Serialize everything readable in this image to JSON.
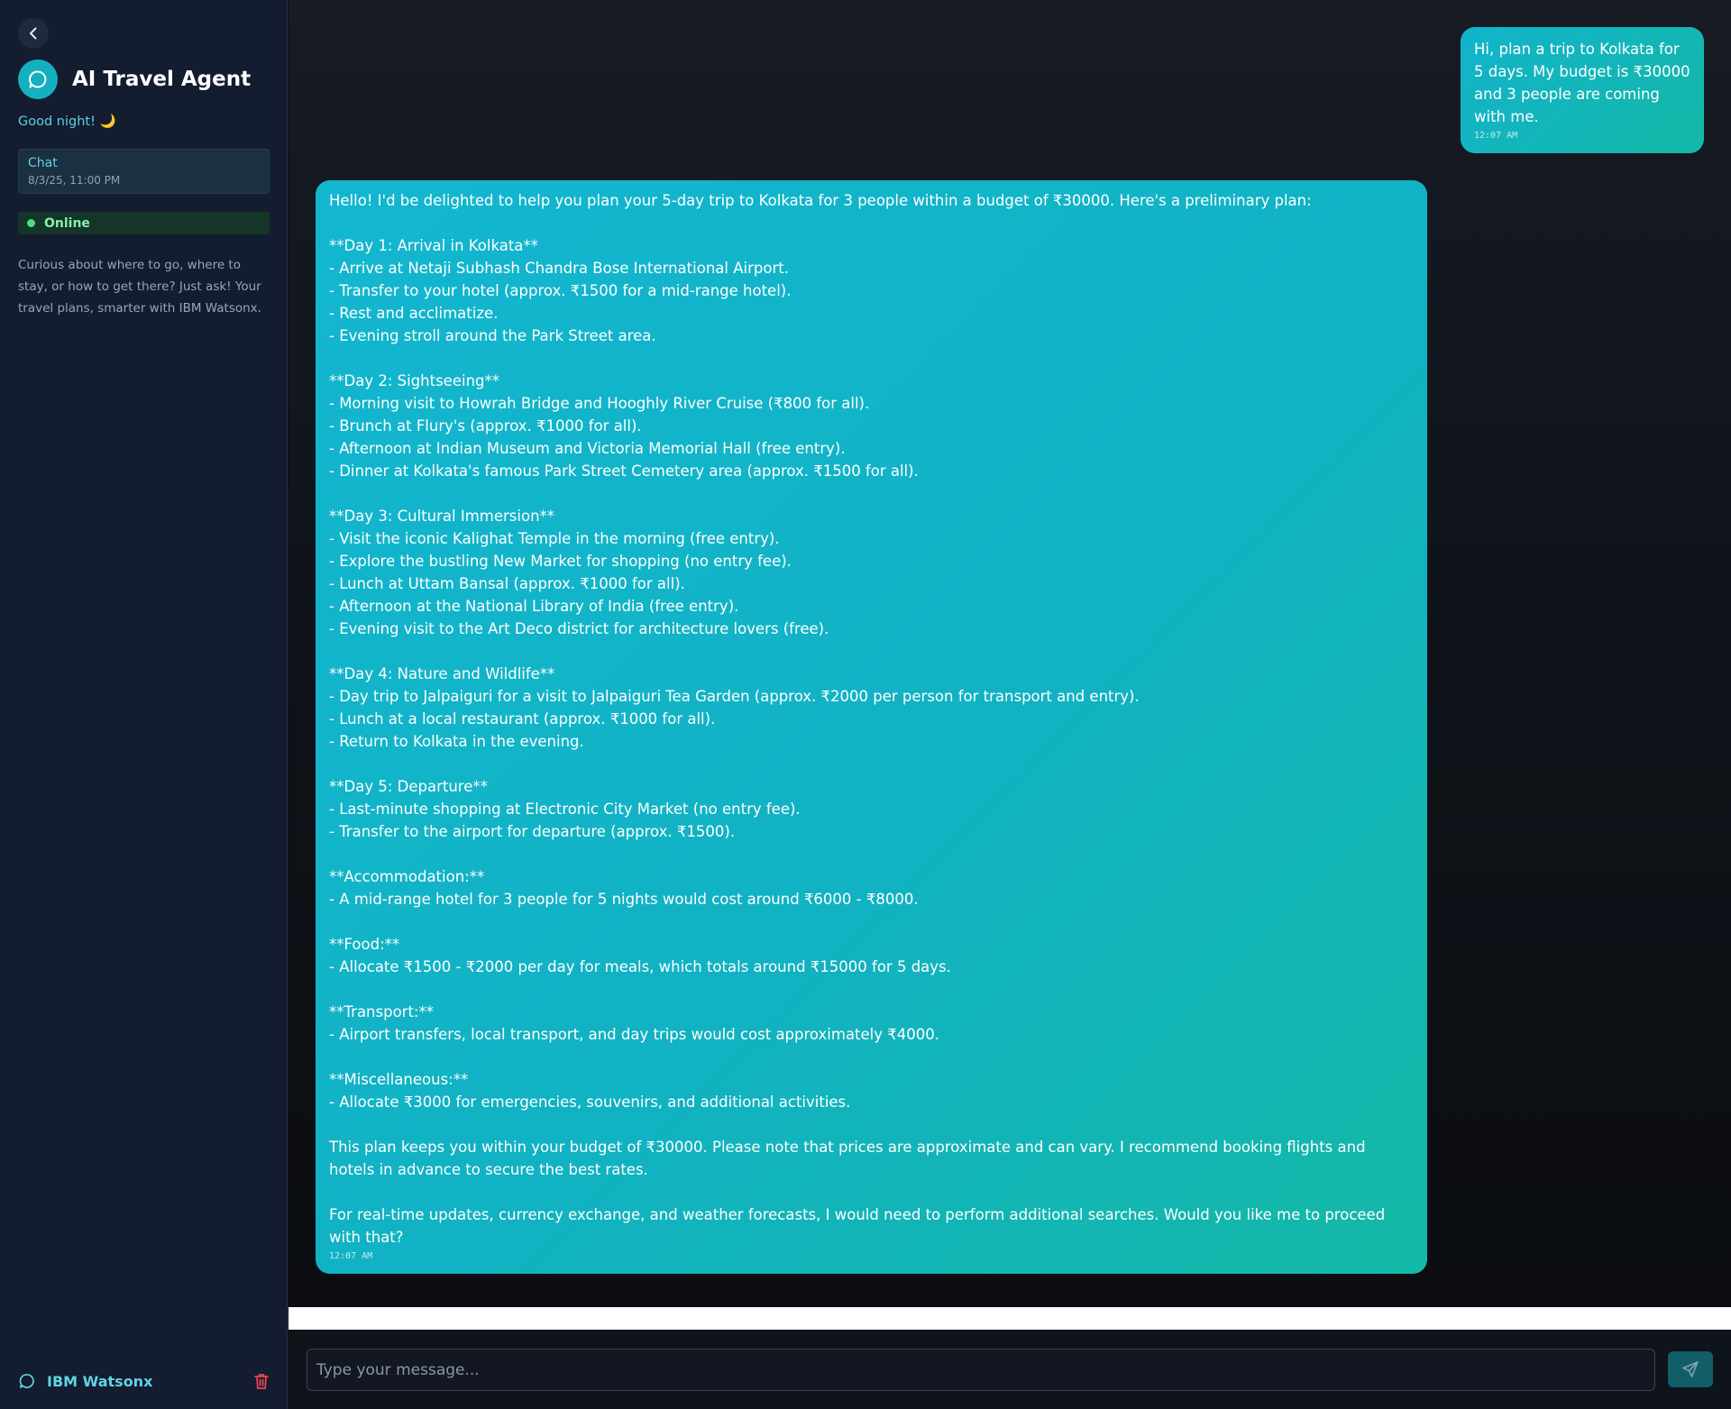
{
  "sidebar": {
    "title": "AI Travel Agent",
    "greeting": "Good night! 🌙",
    "chat_item": {
      "title": "Chat",
      "date": "8/3/25, 11:00 PM"
    },
    "status": "Online",
    "description": "Curious about where to go, where to stay, or how to get there? Just ask! Your travel plans, smarter with IBM Watsonx.",
    "footer_label": "IBM Watsonx"
  },
  "messages": [
    {
      "role": "user",
      "text": "Hi, plan a trip to Kolkata for 5 days. My budget is ₹30000 and 3 people are coming with me.",
      "time": "12:07 AM"
    },
    {
      "role": "assistant",
      "text": "Hello! I'd be delighted to help you plan your 5-day trip to Kolkata for 3 people within a budget of ₹30000. Here's a preliminary plan:\n\n**Day 1: Arrival in Kolkata**\n- Arrive at Netaji Subhash Chandra Bose International Airport.\n- Transfer to your hotel (approx. ₹1500 for a mid-range hotel).\n- Rest and acclimatize.\n- Evening stroll around the Park Street area.\n\n**Day 2: Sightseeing**\n- Morning visit to Howrah Bridge and Hooghly River Cruise (₹800 for all).\n- Brunch at Flury's (approx. ₹1000 for all).\n- Afternoon at Indian Museum and Victoria Memorial Hall (free entry).\n- Dinner at Kolkata's famous Park Street Cemetery area (approx. ₹1500 for all).\n\n**Day 3: Cultural Immersion**\n- Visit the iconic Kalighat Temple in the morning (free entry).\n- Explore the bustling New Market for shopping (no entry fee).\n- Lunch at Uttam Bansal (approx. ₹1000 for all).\n- Afternoon at the National Library of India (free entry).\n- Evening visit to the Art Deco district for architecture lovers (free).\n\n**Day 4: Nature and Wildlife**\n- Day trip to Jalpaiguri for a visit to Jalpaiguri Tea Garden (approx. ₹2000 per person for transport and entry).\n- Lunch at a local restaurant (approx. ₹1000 for all).\n- Return to Kolkata in the evening.\n\n**Day 5: Departure**\n- Last-minute shopping at Electronic City Market (no entry fee).\n- Transfer to the airport for departure (approx. ₹1500).\n\n**Accommodation:**\n- A mid-range hotel for 3 people for 5 nights would cost around ₹6000 - ₹8000.\n\n**Food:**\n- Allocate ₹1500 - ₹2000 per day for meals, which totals around ₹15000 for 5 days.\n\n**Transport:**\n- Airport transfers, local transport, and day trips would cost approximately ₹4000.\n\n**Miscellaneous:**\n- Allocate ₹3000 for emergencies, souvenirs, and additional activities.\n\nThis plan keeps you within your budget of ₹30000. Please note that prices are approximate and can vary. I recommend booking flights and hotels in advance to secure the best rates.\n\nFor real-time updates, currency exchange, and weather forecasts, I would need to perform additional searches. Would you like me to proceed with that?",
      "time": "12:07 AM"
    }
  ],
  "composer": {
    "placeholder": "Type your message...",
    "value": ""
  },
  "icons": {
    "back": "chevron-left-icon",
    "logo": "chat-bubble-icon",
    "footer": "chat-bubble-icon",
    "trash": "trash-icon",
    "send": "send-icon"
  },
  "colors": {
    "accent": "#14b0bf",
    "bubble_start": "#12b3cc",
    "bubble_end": "#14b8a6",
    "online": "#4ade80",
    "danger": "#e5484d"
  }
}
